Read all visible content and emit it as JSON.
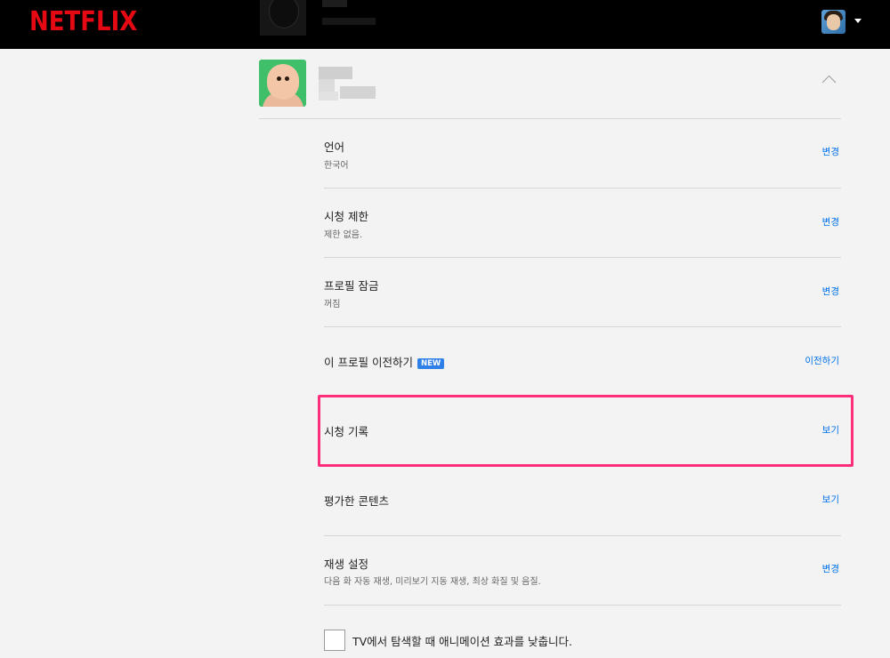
{
  "header": {
    "logo": "NETFLIX"
  },
  "settings": [
    {
      "id": "language",
      "title": "언어",
      "subtitle": "한국어",
      "action": "변경"
    },
    {
      "id": "rating",
      "title": "시청 제한",
      "subtitle": "제한 없음.",
      "action": "변경"
    },
    {
      "id": "lock",
      "title": "프로필 잠금",
      "subtitle": "꺼짐",
      "action": "변경"
    },
    {
      "id": "transfer",
      "title": "이 프로필 이전하기",
      "badge": "NEW",
      "action": "이전하기"
    },
    {
      "id": "history",
      "title": "시청 기록",
      "action": "보기"
    },
    {
      "id": "ratings",
      "title": "평가한 콘텐츠",
      "action": "보기"
    },
    {
      "id": "playback",
      "title": "재생 설정",
      "subtitle": "다음 화 자동 재생, 미리보기 지동 재생, 최상 화질 및 음질.",
      "action": "변경"
    }
  ],
  "animation_option": {
    "label": "TV에서 탐색할 때 애니메이션 효과를 낮춥니다.",
    "checked": false
  },
  "colors": {
    "brand": "#e50914",
    "link": "#0071eb",
    "highlight": "#ff2e7a",
    "badge": "#2e80e8"
  }
}
